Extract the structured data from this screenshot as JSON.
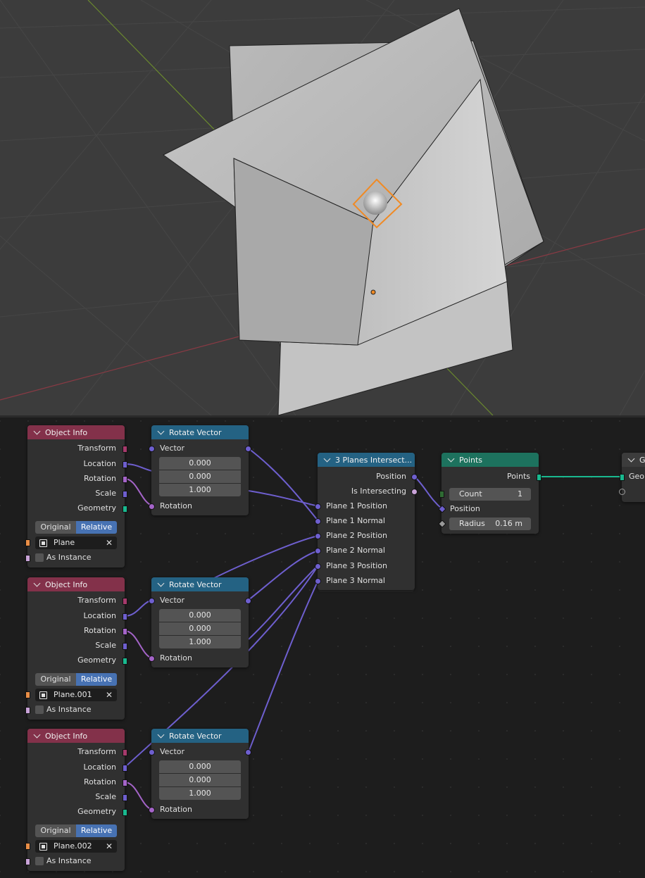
{
  "object_info_nodes": [
    {
      "title": "Object Info",
      "outputs": [
        "Transform",
        "Location",
        "Rotation",
        "Scale",
        "Geometry"
      ],
      "mode_options": [
        "Original",
        "Relative"
      ],
      "mode_selected": "Relative",
      "object": "Plane",
      "as_instance_label": "As Instance"
    },
    {
      "title": "Object Info",
      "outputs": [
        "Transform",
        "Location",
        "Rotation",
        "Scale",
        "Geometry"
      ],
      "mode_options": [
        "Original",
        "Relative"
      ],
      "mode_selected": "Relative",
      "object": "Plane.001",
      "as_instance_label": "As Instance"
    },
    {
      "title": "Object Info",
      "outputs": [
        "Transform",
        "Location",
        "Rotation",
        "Scale",
        "Geometry"
      ],
      "mode_options": [
        "Original",
        "Relative"
      ],
      "mode_selected": "Relative",
      "object": "Plane.002",
      "as_instance_label": "As Instance"
    }
  ],
  "rotate_vector_nodes": [
    {
      "title": "Rotate Vector",
      "output": "Vector",
      "values": [
        "0.000",
        "0.000",
        "1.000"
      ],
      "input": "Rotation"
    },
    {
      "title": "Rotate Vector",
      "output": "Vector",
      "values": [
        "0.000",
        "0.000",
        "1.000"
      ],
      "input": "Rotation"
    },
    {
      "title": "Rotate Vector",
      "output": "Vector",
      "values": [
        "0.000",
        "0.000",
        "1.000"
      ],
      "input": "Rotation"
    }
  ],
  "intersect_node": {
    "title": "3 Planes Intersect...",
    "outputs": [
      "Position",
      "Is Intersecting"
    ],
    "inputs": [
      "Plane 1 Position",
      "Plane 1 Normal",
      "Plane 2 Position",
      "Plane 2 Normal",
      "Plane 3 Position",
      "Plane 3 Normal"
    ]
  },
  "points_node": {
    "title": "Points",
    "output": "Points",
    "count_label": "Count",
    "count_value": "1",
    "position_label": "Position",
    "radius_label": "Radius",
    "radius_value": "0.16 m"
  },
  "output_node": {
    "title": "G",
    "socket_label": "Geom"
  },
  "colors": {
    "header_input": "#83314a",
    "header_vector": "#246283",
    "header_geometry": "#1d725e",
    "socket_vector": "#6e5fcf",
    "socket_rotation": "#a464c8",
    "socket_geometry": "#19b98f",
    "socket_matrix": "#a63a6c",
    "socket_object": "#e98e46",
    "selection_outline": "#f08a24"
  }
}
